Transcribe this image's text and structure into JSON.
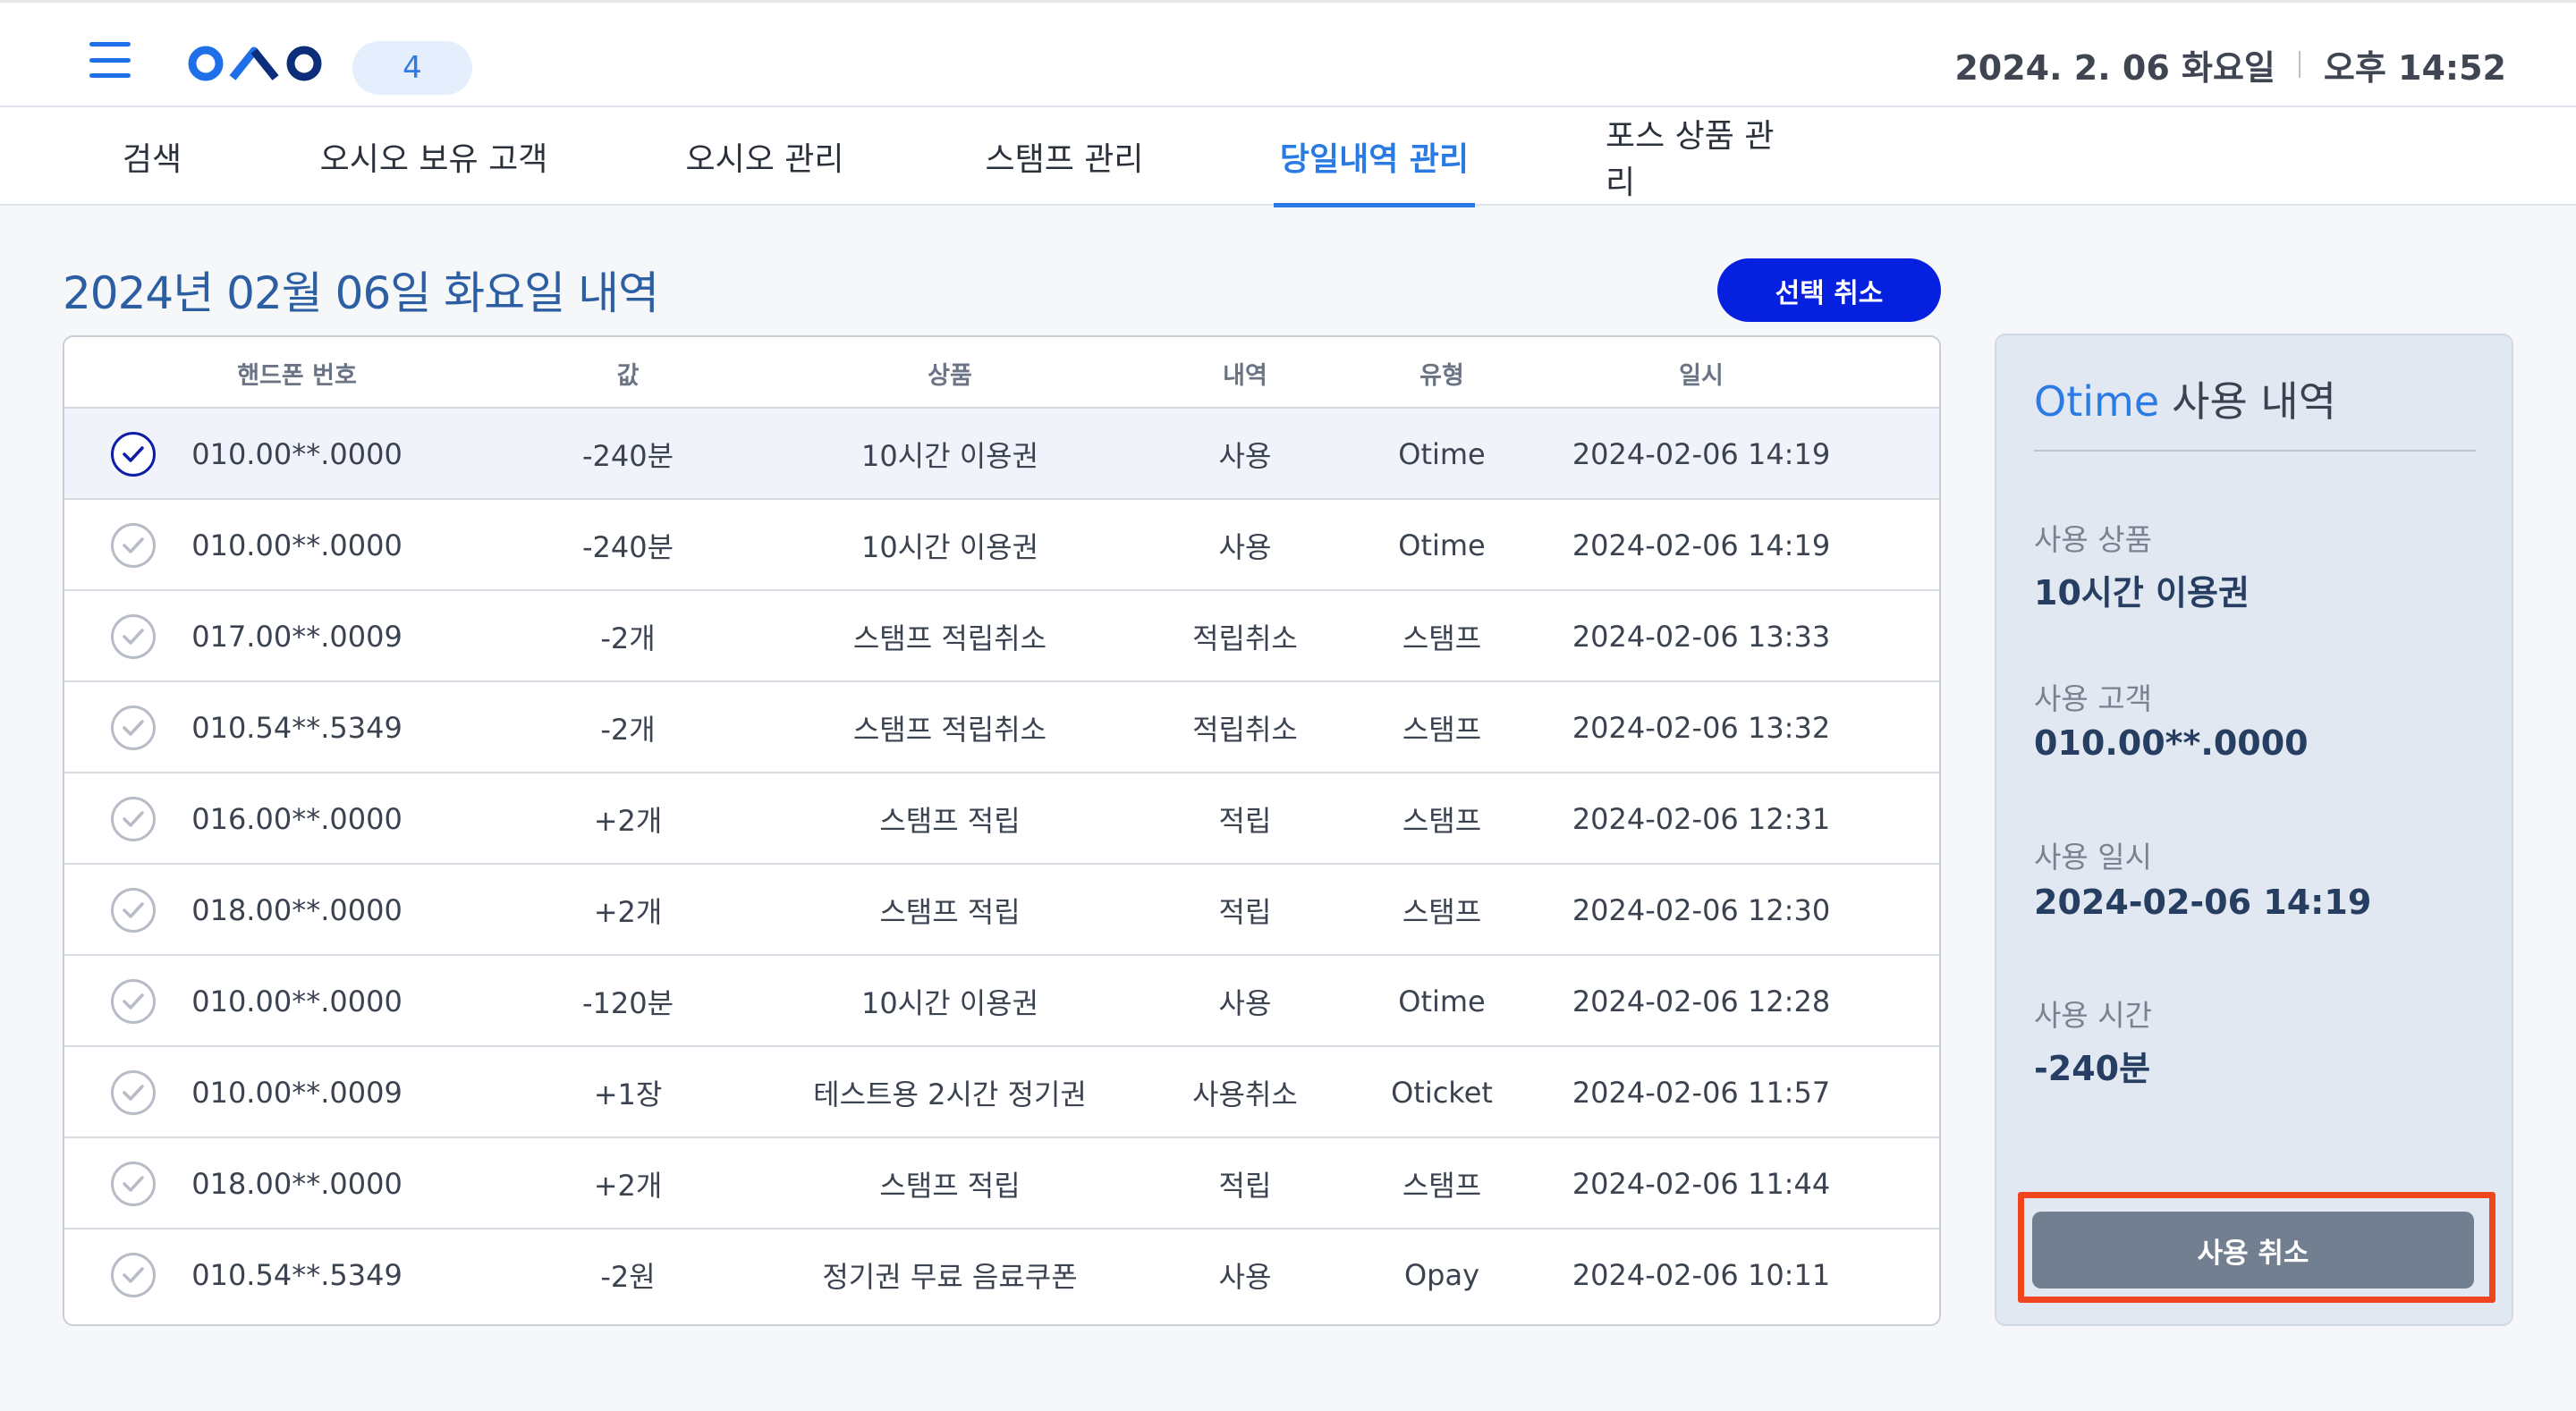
{
  "header": {
    "badge_count": "4",
    "date": "2024. 2. 06 화요일",
    "time": "오후 14:52",
    "brand_color": "#1e6fe8"
  },
  "tabs": [
    {
      "label": "검색",
      "active": false
    },
    {
      "label": "오시오 보유 고객",
      "active": false
    },
    {
      "label": "오시오 관리",
      "active": false
    },
    {
      "label": "스탬프 관리",
      "active": false
    },
    {
      "label": "당일내역 관리",
      "active": true
    },
    {
      "label": "포스 상품 관리",
      "active": false
    }
  ],
  "main": {
    "title": "2024년 02월 06일 화요일 내역",
    "cancel_selected_label": "선택 취소"
  },
  "table": {
    "columns": [
      "핸드폰 번호",
      "값",
      "상품",
      "내역",
      "유형",
      "일시"
    ],
    "rows": [
      {
        "phone": "010.00**.0000",
        "value": "-240분",
        "product": "10시간 이용권",
        "history": "사용",
        "type": "Otime",
        "datetime": "2024-02-06 14:19",
        "selected": true
      },
      {
        "phone": "010.00**.0000",
        "value": "-240분",
        "product": "10시간 이용권",
        "history": "사용",
        "type": "Otime",
        "datetime": "2024-02-06 14:19",
        "selected": false
      },
      {
        "phone": "017.00**.0009",
        "value": "-2개",
        "product": "스탬프 적립취소",
        "history": "적립취소",
        "type": "스탬프",
        "datetime": "2024-02-06 13:33",
        "selected": false
      },
      {
        "phone": "010.54**.5349",
        "value": "-2개",
        "product": "스탬프 적립취소",
        "history": "적립취소",
        "type": "스탬프",
        "datetime": "2024-02-06 13:32",
        "selected": false
      },
      {
        "phone": "016.00**.0000",
        "value": "+2개",
        "product": "스탬프 적립",
        "history": "적립",
        "type": "스탬프",
        "datetime": "2024-02-06 12:31",
        "selected": false
      },
      {
        "phone": "018.00**.0000",
        "value": "+2개",
        "product": "스탬프 적립",
        "history": "적립",
        "type": "스탬프",
        "datetime": "2024-02-06 12:30",
        "selected": false
      },
      {
        "phone": "010.00**.0000",
        "value": "-120분",
        "product": "10시간 이용권",
        "history": "사용",
        "type": "Otime",
        "datetime": "2024-02-06 12:28",
        "selected": false
      },
      {
        "phone": "010.00**.0009",
        "value": "+1장",
        "product": "테스트용 2시간 정기권",
        "history": "사용취소",
        "type": "Oticket",
        "datetime": "2024-02-06 11:57",
        "selected": false
      },
      {
        "phone": "018.00**.0000",
        "value": "+2개",
        "product": "스탬프 적립",
        "history": "적립",
        "type": "스탬프",
        "datetime": "2024-02-06 11:44",
        "selected": false
      },
      {
        "phone": "010.54**.5349",
        "value": "-2원",
        "product": "정기권 무료 음료쿠폰",
        "history": "사용",
        "type": "Opay",
        "datetime": "2024-02-06 10:11",
        "selected": false
      }
    ]
  },
  "panel": {
    "title_accent": "Otime",
    "title_rest": "사용 내역",
    "fields": [
      {
        "label": "사용 상품",
        "value": "10시간 이용권"
      },
      {
        "label": "사용 고객",
        "value": "010.00**.0000"
      },
      {
        "label": "사용 일시",
        "value": "2024-02-06 14:19"
      },
      {
        "label": "사용 시간",
        "value": "-240분"
      }
    ],
    "cancel_label": "사용 취소",
    "highlight_color": "#f0441e"
  }
}
